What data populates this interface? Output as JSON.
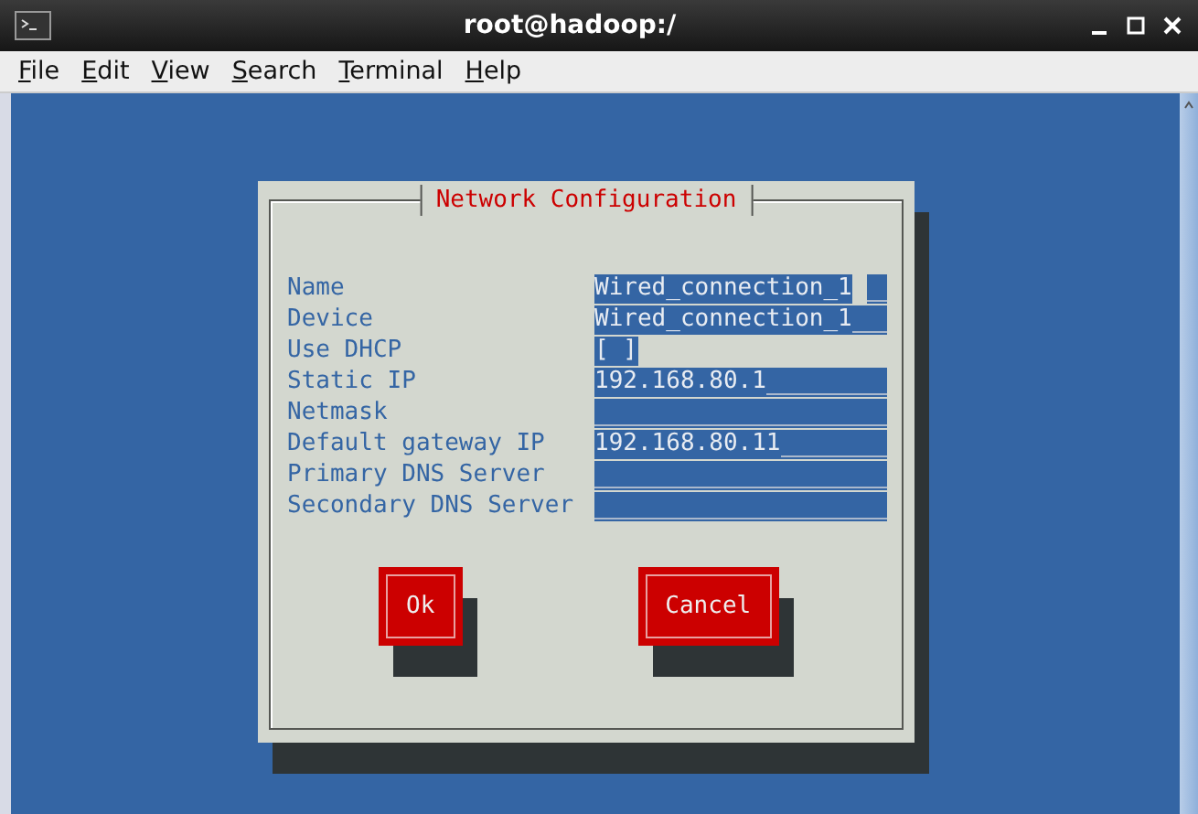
{
  "window": {
    "title": "root@hadoop:/"
  },
  "menu": [
    {
      "label": "File"
    },
    {
      "label": "Edit"
    },
    {
      "label": "View"
    },
    {
      "label": "Search"
    },
    {
      "label": "Terminal"
    },
    {
      "label": "Help"
    }
  ],
  "dialog": {
    "title": "Network Configuration",
    "fields": [
      {
        "kind": "text",
        "label": "Name",
        "value": "Wired_connection_1",
        "focused": true
      },
      {
        "kind": "text",
        "label": "Device",
        "value": "Wired_connection_1",
        "focused": false
      },
      {
        "kind": "checkbox",
        "label": "Use DHCP",
        "value": "[ ]",
        "checked": false,
        "focused": false
      },
      {
        "kind": "text",
        "label": "Static IP",
        "value": "192.168.80.1",
        "focused": false
      },
      {
        "kind": "text",
        "label": "Netmask",
        "focused": false
      },
      {
        "kind": "text",
        "label": "Default gateway IP",
        "value": "192.168.80.11",
        "focused": false
      },
      {
        "kind": "text",
        "label": "Primary DNS Server",
        "focused": false
      },
      {
        "kind": "text",
        "label": "Secondary DNS Server",
        "focused": false
      }
    ],
    "buttons": [
      {
        "label": "Ok"
      },
      {
        "label": "Cancel"
      }
    ]
  }
}
